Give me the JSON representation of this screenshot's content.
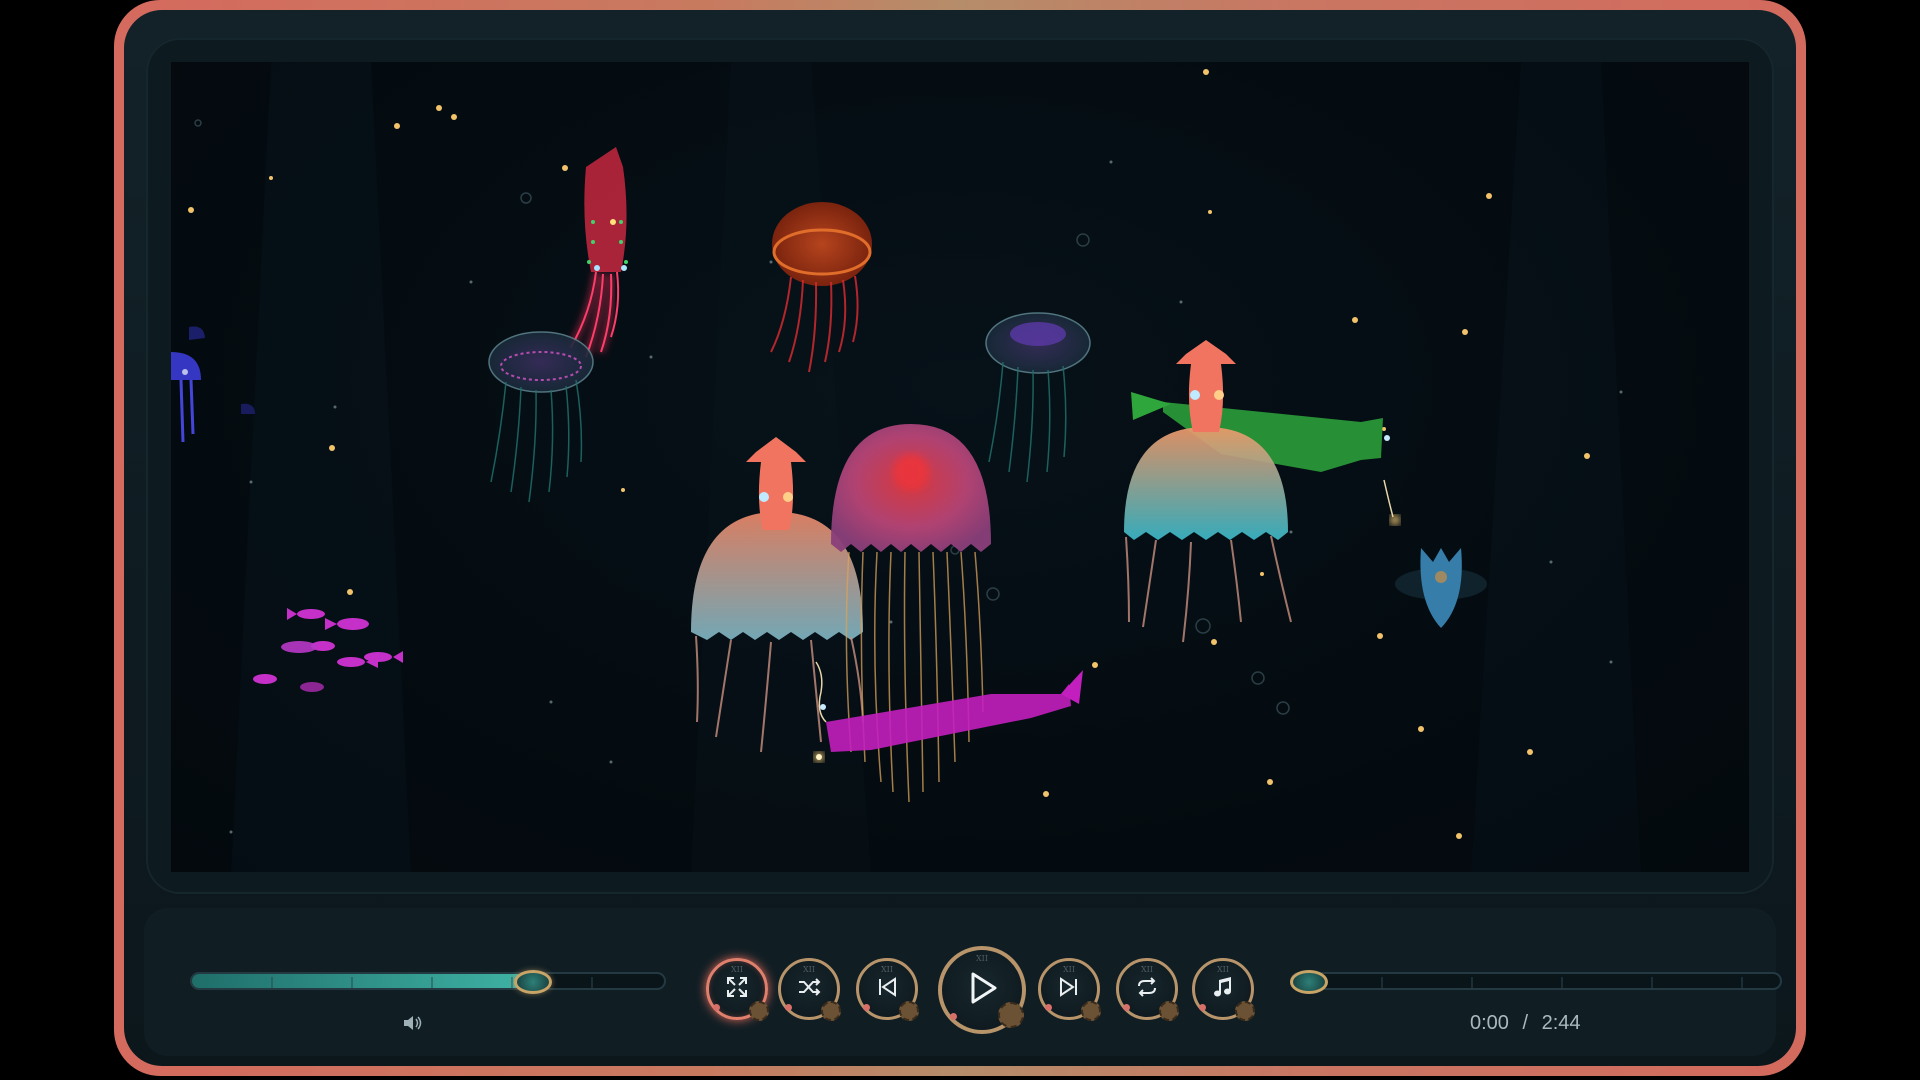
{
  "player": {
    "time_current": "0:00",
    "time_separator": "/",
    "time_total": "2:44",
    "volume_level": 0.72,
    "seek_level": 0.0
  },
  "controls": {
    "buttons": [
      {
        "name": "fullscreen-button",
        "icon": "expand-icon",
        "numeral": "XII",
        "active": true
      },
      {
        "name": "shuffle-button",
        "icon": "shuffle-icon",
        "numeral": "XII",
        "active": false
      },
      {
        "name": "previous-button",
        "icon": "skip-back-icon",
        "numeral": "XII",
        "active": false
      },
      {
        "name": "play-button",
        "icon": "play-icon",
        "numeral": "XII",
        "active": false
      },
      {
        "name": "next-button",
        "icon": "skip-forward-icon",
        "numeral": "XII",
        "active": false
      },
      {
        "name": "repeat-button",
        "icon": "repeat-icon",
        "numeral": "XII",
        "active": false
      },
      {
        "name": "music-button",
        "icon": "music-note-icon",
        "numeral": "XII",
        "active": false
      }
    ]
  },
  "icons": {
    "volume": "speaker-icon"
  },
  "colors": {
    "frame_accent": "#d56a5e",
    "gold_ring": "#b8946a",
    "teal_fill": "#3fb3a5",
    "background": "#040b10"
  }
}
